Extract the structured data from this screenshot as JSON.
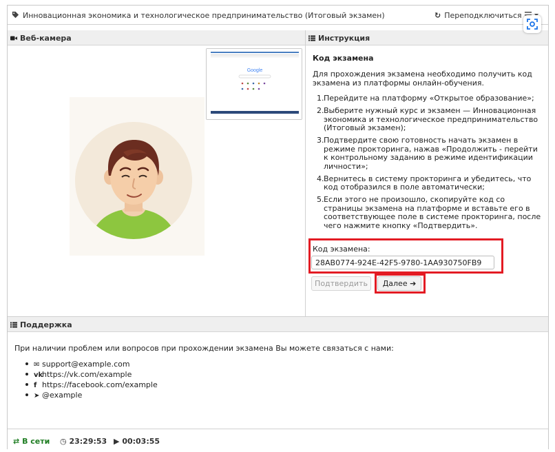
{
  "header": {
    "title": "Инновационная экономика и технологическое предпринимательство (Итоговый экзамен)",
    "reconnect_label": "Переподключиться",
    "tag_icon": "tag-icon",
    "reconnect_icon": "refresh-icon",
    "menu_icon": "hamburger-icon",
    "scan_icon": "camera-scan-icon"
  },
  "webcam": {
    "title": "Веб-камера",
    "icon": "video-camera-icon",
    "thumbnail_logo": "Google"
  },
  "instructions": {
    "title": "Инструкция",
    "icon": "list-icon",
    "heading": "Код экзамена",
    "intro": "Для прохождения экзамена необходимо получить код экзамена из платформы онлайн-обучения.",
    "steps": [
      {
        "num": "1.",
        "text": "Перейдите на платформу «Открытое образование»;"
      },
      {
        "num": "2.",
        "text": "Выберите нужный курс и экзамен — Инновационная экономика и технологическое предпринимательство (Итоговый экзамен);"
      },
      {
        "num": "3.",
        "text": "Подтвердите свою готовность начать экзамен в режиме прокторинга, нажав «Продолжить - перейти к контрольному заданию в режиме идентификации личности»;"
      },
      {
        "num": "4.",
        "text": "Вернитесь в систему прокторинга и убедитесь, что код отобразился в поле автоматически;"
      },
      {
        "num": "5.",
        "text": "Если этого не произошло, скопируйте код со страницы экзамена на платформе и вставьте его в соответствующее поле в системе прокторинга, после чего нажмите кнопку «Подтвердить»."
      }
    ],
    "code_label": "Код экзамена:",
    "code_value": "28AB0774-924E-42F5-9780-1AA930750FB9",
    "confirm_label": "Подтвердить",
    "next_label": "Далее",
    "next_icon": "arrow-right-icon",
    "highlight_color": "#e31b23"
  },
  "support": {
    "title": "Поддержка",
    "icon": "list-icon",
    "text": "При наличии проблем или вопросов при прохождении экзамена Вы можете связаться с нами:",
    "contacts": [
      {
        "icon": "envelope-icon",
        "glyph": "✉",
        "value": "support@example.com"
      },
      {
        "icon": "vk-icon",
        "glyph": "vk",
        "value": "https://vk.com/example"
      },
      {
        "icon": "facebook-icon",
        "glyph": "f",
        "value": "https://facebook.com/example"
      },
      {
        "icon": "telegram-icon",
        "glyph": "➤",
        "value": "@example"
      }
    ]
  },
  "status": {
    "online_label": "В сети",
    "online_color": "#1e7d22",
    "clock": "23:29:53",
    "timer": "00:03:55"
  }
}
